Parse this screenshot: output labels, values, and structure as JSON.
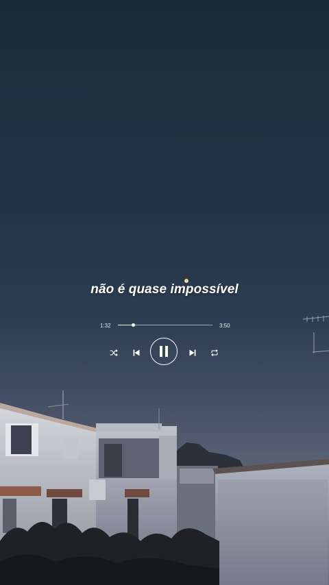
{
  "lyric": "não é quase impossível",
  "player": {
    "elapsed": "1:32",
    "total": "3:50",
    "progress": 0.16,
    "state": "playing"
  },
  "controls": {
    "shuffle_icon": "shuffle-icon",
    "prev_icon": "skip-previous-icon",
    "play_pause_icon": "pause-icon",
    "next_icon": "skip-next-icon",
    "repeat_icon": "repeat-icon"
  },
  "colors": {
    "sky_top": "#1c2b3b",
    "sky_horizon": "#5a6478",
    "text": "#ffffff"
  }
}
